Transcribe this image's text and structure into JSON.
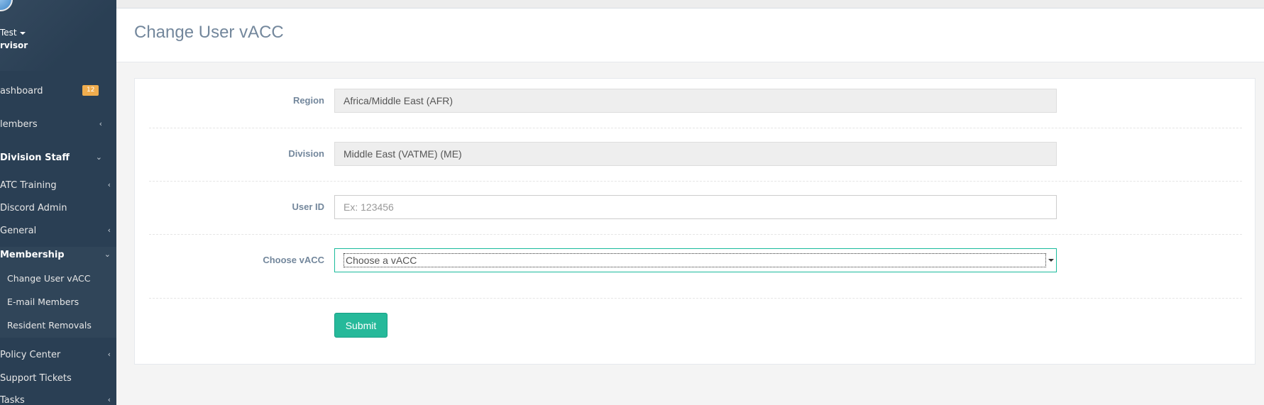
{
  "sidebar": {
    "user_name": "Test",
    "user_role": "rvisor",
    "items": [
      {
        "label": "ashboard",
        "badge": "12"
      },
      {
        "label": "lembers"
      },
      {
        "label": "Division Staff"
      },
      {
        "label": "ATC Training"
      },
      {
        "label": "Discord Admin"
      },
      {
        "label": "General"
      },
      {
        "label": "Membership"
      },
      {
        "label": "Change User vACC"
      },
      {
        "label": "E-mail Members"
      },
      {
        "label": "Resident Removals"
      },
      {
        "label": "Policy Center"
      },
      {
        "label": "Support Tickets"
      },
      {
        "label": "Tasks"
      }
    ]
  },
  "page": {
    "title": "Change User vACC"
  },
  "form": {
    "region_label": "Region",
    "region_value": "Africa/Middle East (AFR)",
    "division_label": "Division",
    "division_value": "Middle East (VATME) (ME)",
    "userid_label": "User ID",
    "userid_placeholder": "Ex: 123456",
    "vacc_label": "Choose vACC",
    "vacc_selected": "Choose a vACC",
    "submit_label": "Submit"
  },
  "colors": {
    "sidebar_bg": "#2a3f54",
    "accent": "#1abb9c",
    "badge": "#f0ad4e"
  }
}
